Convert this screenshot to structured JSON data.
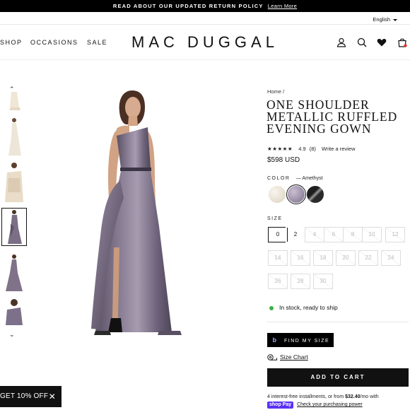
{
  "announcement": {
    "text": "READ ABOUT OUR UPDATED RETURN POLICY",
    "link": "Learn More"
  },
  "language": "English",
  "nav": {
    "left": [
      "SHOP",
      "OCCASIONS",
      "SALE"
    ]
  },
  "logo": "MAC DUGGAL",
  "icons": {
    "account": "user-icon",
    "search": "search-icon",
    "wishlist": "heart-icon",
    "cart": "bag-icon"
  },
  "breadcrumb": {
    "home": "Home",
    "sep": "/"
  },
  "product": {
    "title": "ONE SHOULDER METALLIC RUFFLED EVENING GOWN",
    "stars": "★★★★★",
    "rating": "4.9",
    "reviews": "(8)",
    "write_review": "Write a review",
    "price": "$598 USD",
    "color_label": "COLOR",
    "color_value": "— Amethyst",
    "size_label": "SIZE",
    "sizes": [
      "0",
      "2",
      "4",
      "6",
      "8",
      "10",
      "12",
      "14",
      "16",
      "18",
      "20",
      "22",
      "24",
      "26",
      "28",
      "30"
    ],
    "selected_size": "0",
    "stock": "In stock, ready to ship",
    "find_size": "FIND MY SIZE",
    "size_chart": "Size Chart",
    "add_to_cart": "ADD TO CART",
    "install_1": "4 interest-free installments, or from",
    "install_amount": "$32.40",
    "install_2": "/mo with",
    "shoppay": "shop Pay",
    "check_power": "Check your purchasing power"
  },
  "promo": {
    "text": "GET 10% OFF"
  },
  "colors": {
    "amethyst": "#8a7d96",
    "champagne": "#e9e2d6",
    "black_silver": "#2c2c2c"
  }
}
